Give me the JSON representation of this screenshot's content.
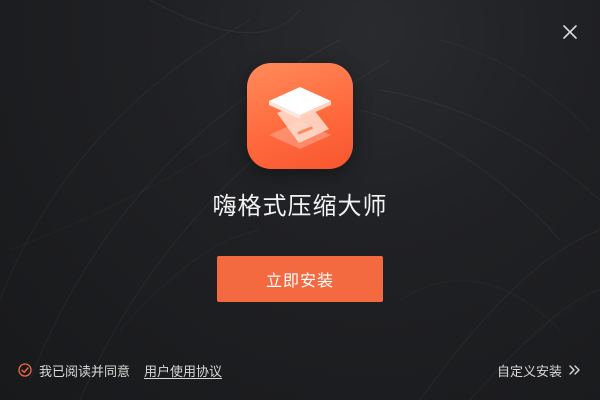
{
  "window": {
    "close_icon": "close-icon"
  },
  "app": {
    "icon": "compress-layers-icon",
    "title": "嗨格式压缩大师",
    "accent_color": "#f36a41"
  },
  "actions": {
    "install_label": "立即安装",
    "custom_install_label": "自定义安装",
    "custom_install_icon": "double-chevron-right-icon"
  },
  "agreement": {
    "checked": true,
    "check_icon": "checked-circle-icon",
    "agree_text": "我已阅读并同意",
    "link_text": "用户使用协议"
  }
}
